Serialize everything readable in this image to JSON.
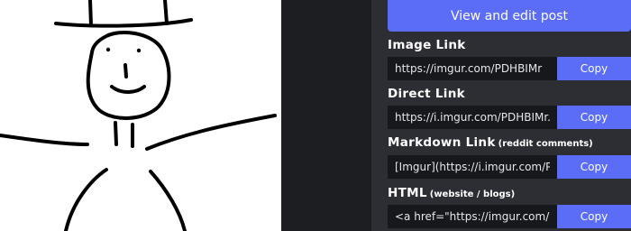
{
  "post_button": {
    "label": "View and edit post"
  },
  "links": [
    {
      "title": "Image Link",
      "subtitle": "",
      "value": "https://imgur.com/PDHBIMr",
      "copy_label": "Copy"
    },
    {
      "title": "Direct Link",
      "subtitle": "",
      "value": "https://i.imgur.com/PDHBIMr.png",
      "copy_label": "Copy"
    },
    {
      "title": "Markdown Link",
      "subtitle": "(reddit comments)",
      "value": "[Imgur](https://i.imgur.com/PDHBIMr.png)",
      "copy_label": "Copy"
    },
    {
      "title": "HTML",
      "subtitle": "(website / blogs)",
      "value": "<a href=\"https://imgur.com/PDHBIMr\"><img src=\"https://i.imgur.com/PDHBIMr.png\" title=\"source: imgur.com\" /></a>",
      "copy_label": "Copy"
    }
  ],
  "colors": {
    "accent": "#5b6cf6",
    "panel": "#2d2e34",
    "background": "#1d1e22",
    "input": "#17181b"
  }
}
